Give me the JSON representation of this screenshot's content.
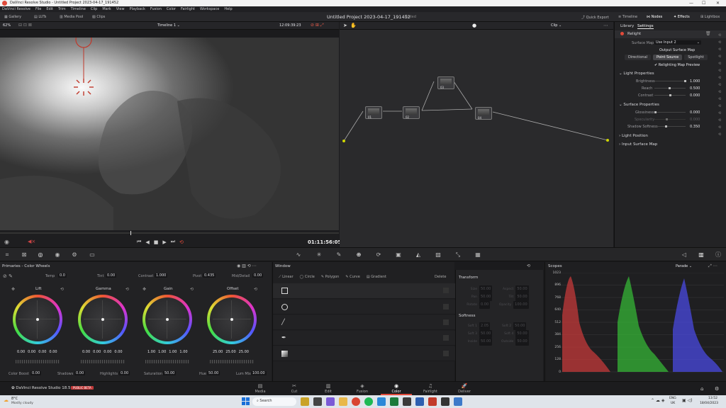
{
  "titlebar": {
    "title": "DaVinci Resolve Studio - Untitled Project 2023-04-17_191452"
  },
  "menu": [
    "DaVinci Resolve",
    "File",
    "Edit",
    "Trim",
    "Timeline",
    "Clip",
    "Mark",
    "View",
    "Playback",
    "Fusion",
    "Color",
    "Fairlight",
    "Workspace",
    "Help"
  ],
  "toolbar": {
    "left": [
      "Gallery",
      "LUTs",
      "Media Pool",
      "Clips"
    ],
    "project_title": "Untitled Project 2023-04-17_191452",
    "project_status": "Edited",
    "right": [
      "Quick Export",
      "Timeline",
      "Nodes",
      "Effects",
      "Lightbox"
    ]
  },
  "viewer": {
    "zoom": "62%",
    "timeline": "Timeline 1",
    "timecode": "12:09:39:23",
    "playhead_tc": "01:11:56:05"
  },
  "nodegraph": {
    "mode": "Clip",
    "nodes": [
      "01",
      "02",
      "03",
      "04"
    ]
  },
  "settings": {
    "tabs": [
      "Library",
      "Settings"
    ],
    "effect": "Relight",
    "surface_map_label": "Surface Map",
    "surface_map_value": "Use Input 2",
    "output_surface_map": "Output Surface Map",
    "light_types": [
      "Directional",
      "Point Source",
      "Spotlight"
    ],
    "relighting_preview": "Relighting Map Preview",
    "light_properties": "Light Properties",
    "brightness": {
      "label": "Brightness",
      "value": "1.000"
    },
    "reach": {
      "label": "Reach",
      "value": "0.500"
    },
    "contrast": {
      "label": "Contrast",
      "value": "0.000"
    },
    "surface_properties": "Surface Properties",
    "glossiness": {
      "label": "Glossiness",
      "value": "0.000"
    },
    "specularity": {
      "label": "Specularity",
      "value": "0.000"
    },
    "shadow_softness": {
      "label": "Shadow Softness",
      "value": "0.350"
    },
    "light_position": "Light Position",
    "input_surface_map": "Input Surface Map"
  },
  "primaries": {
    "title": "Primaries - Color Wheels",
    "temp": {
      "label": "Temp",
      "value": "0.0"
    },
    "tint": {
      "label": "Tint",
      "value": "0.00"
    },
    "contrast": {
      "label": "Contrast",
      "value": "1.000"
    },
    "pivot": {
      "label": "Pivot",
      "value": "0.435"
    },
    "middetail": {
      "label": "Mid/Detail",
      "value": "0.00"
    },
    "wheels": [
      {
        "name": "Lift",
        "values": [
          "0.00",
          "0.00",
          "0.00",
          "0.00"
        ]
      },
      {
        "name": "Gamma",
        "values": [
          "0.00",
          "0.00",
          "0.00",
          "0.00"
        ]
      },
      {
        "name": "Gain",
        "values": [
          "1.00",
          "1.00",
          "1.00",
          "1.00"
        ]
      },
      {
        "name": "Offset",
        "values": [
          "25.00",
          "25.00",
          "25.00"
        ]
      }
    ],
    "color_boost": {
      "label": "Color Boost",
      "value": "0.00"
    },
    "shadows": {
      "label": "Shadows",
      "value": "0.00"
    },
    "highlights": {
      "label": "Highlights",
      "value": "0.00"
    },
    "saturation": {
      "label": "Saturation",
      "value": "50.00"
    },
    "hue": {
      "label": "Hue",
      "value": "50.00"
    },
    "lum_mix": {
      "label": "Lum Mix",
      "value": "100.00"
    }
  },
  "window": {
    "title": "Window",
    "shapes": [
      "Linear",
      "Circle",
      "Polygon",
      "Curve",
      "Gradient"
    ],
    "delete": "Delete"
  },
  "transform": {
    "title": "Transform",
    "rows": [
      [
        "Size",
        "50.00",
        "Aspect",
        "50.00"
      ],
      [
        "Pan",
        "50.00",
        "Tilt",
        "50.00"
      ],
      [
        "Rotate",
        "0.00",
        "Opacity",
        "100.00"
      ]
    ],
    "softness_title": "Softness",
    "softness_rows": [
      [
        "Soft 1",
        "2.05",
        "Soft 2",
        "50.00"
      ],
      [
        "Soft 3",
        "50.00",
        "Soft 4",
        "50.00"
      ],
      [
        "Inside",
        "50.00",
        "Outside",
        "50.00"
      ]
    ]
  },
  "scopes": {
    "title": "Scopes",
    "mode": "Parade",
    "scale": [
      "1023",
      "896",
      "768",
      "640",
      "512",
      "384",
      "256",
      "128",
      "0"
    ]
  },
  "pages": [
    "Media",
    "Cut",
    "Edit",
    "Fusion",
    "Color",
    "Fairlight",
    "Deliver"
  ],
  "brand": {
    "name": "DaVinci Resolve Studio 18.5",
    "badge": "PUBLIC BETA"
  },
  "taskbar": {
    "weather_temp": "8°C",
    "weather_desc": "Mostly cloudy",
    "search": "Search",
    "lang": "ENG",
    "region": "UK",
    "time": "13:52",
    "date": "18/04/2023"
  }
}
